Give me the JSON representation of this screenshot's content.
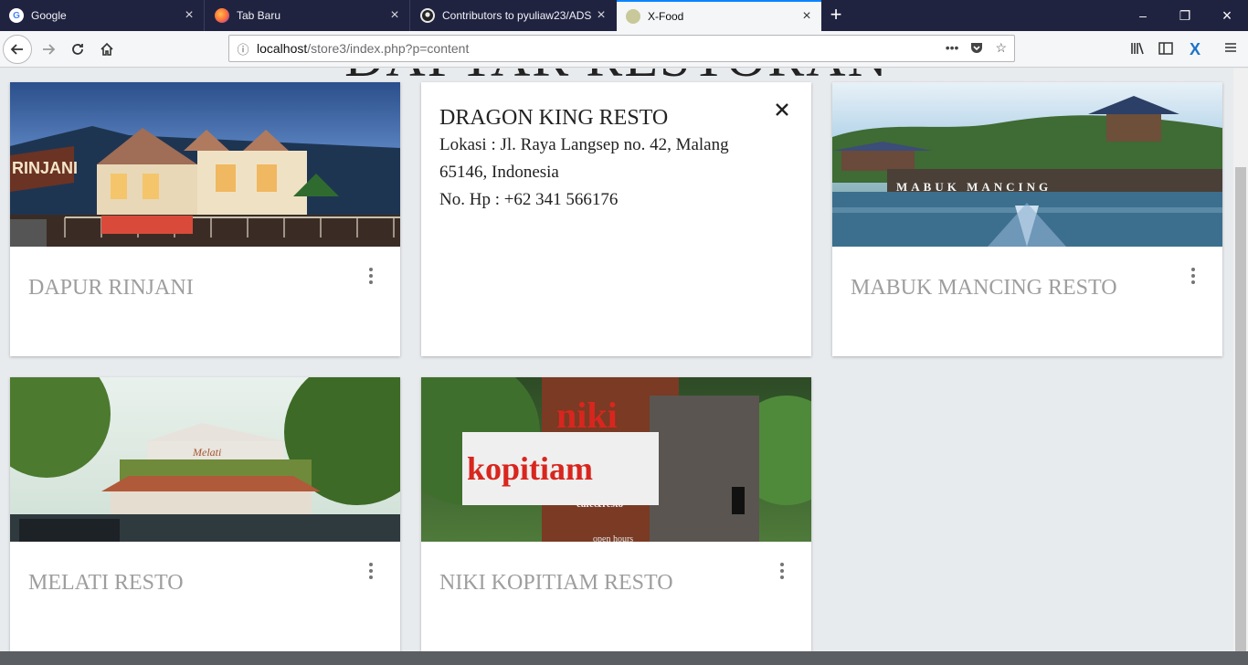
{
  "browser": {
    "tabs": [
      {
        "title": "Google",
        "icon": "google-icon",
        "active": false
      },
      {
        "title": "Tab Baru",
        "icon": "firefox-icon",
        "active": false
      },
      {
        "title": "Contributors to pyuliaw23/ADS",
        "icon": "github-icon",
        "active": false
      },
      {
        "title": "X-Food",
        "icon": "site-icon",
        "active": true
      }
    ],
    "url_host": "localhost",
    "url_path": "/store3/index.php?p=content"
  },
  "page": {
    "heading": "DAFTAR RESTORAN"
  },
  "restaurants": [
    {
      "name": "DAPUR RINJANI",
      "photo_sign": "RINJANI"
    },
    {
      "name": "MABUK MANCING RESTO",
      "photo_sign": "MABUK MANCING"
    },
    {
      "name": "MELATI RESTO",
      "photo_sign": "Melati"
    },
    {
      "name": "NIKI KOPITIAM RESTO",
      "photo_sign": "niki",
      "photo_sign2": "kopitiam",
      "photo_sign3": "cafe&resto",
      "photo_sign4": "open hours"
    }
  ],
  "revealed": {
    "name": "DRAGON KING RESTO",
    "lokasi": "Lokasi : Jl. Raya Langsep no. 42, Malang",
    "lokasi_2": "65146, Indonesia",
    "hp": "No. Hp : +62 341 566176"
  },
  "colors": {
    "tabstrip": "#202340",
    "active_tab_accent": "#0a84ff",
    "page_bg": "#e8ebee",
    "card_title": "#9e9e9e"
  }
}
